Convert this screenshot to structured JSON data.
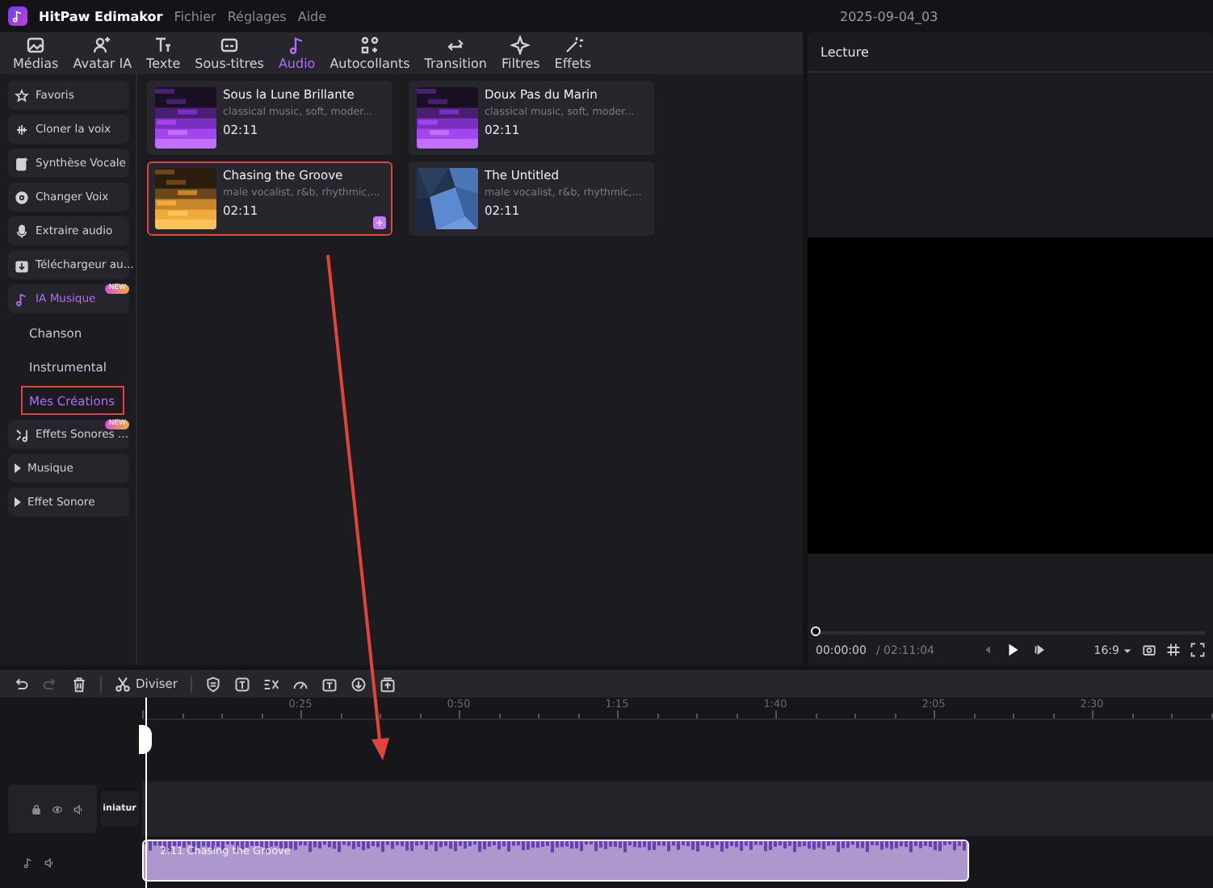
{
  "app": {
    "name": "HitPaw Edimakor",
    "menu": [
      "Fichier",
      "Réglages",
      "Aide"
    ],
    "project": "2025-09-04_03"
  },
  "tabs": [
    {
      "label": "Médias",
      "selected": false
    },
    {
      "label": "Avatar IA",
      "selected": false
    },
    {
      "label": "Texte",
      "selected": false
    },
    {
      "label": "Sous-titres",
      "selected": false
    },
    {
      "label": "Audio",
      "selected": true
    },
    {
      "label": "Autocollants",
      "selected": false
    },
    {
      "label": "Transition",
      "selected": false
    },
    {
      "label": "Filtres",
      "selected": false
    },
    {
      "label": "Effets",
      "selected": false
    }
  ],
  "sidebar": {
    "items": [
      {
        "label": "Favoris",
        "kind": "item",
        "selected": false
      },
      {
        "label": "Cloner la voix",
        "kind": "item",
        "selected": false
      },
      {
        "label": "Synthèse Vocale",
        "kind": "item",
        "selected": false
      },
      {
        "label": "Changer Voix",
        "kind": "item",
        "selected": false
      },
      {
        "label": "Extraire audio",
        "kind": "item",
        "selected": false
      },
      {
        "label": "Téléchargeur au...",
        "kind": "item",
        "selected": false
      },
      {
        "label": "IA Musique",
        "kind": "item",
        "selected": true,
        "badge": "NEW",
        "children": [
          {
            "label": "Chanson",
            "selected": false
          },
          {
            "label": "Instrumental",
            "selected": false
          },
          {
            "label": "Mes Créations",
            "selected": true
          }
        ]
      },
      {
        "label": "Effets Sonores ...",
        "kind": "item",
        "selected": false,
        "badge": "NEW"
      },
      {
        "label": "Musique",
        "kind": "folder",
        "selected": false,
        "expanded": false
      },
      {
        "label": "Effet Sonore",
        "kind": "folder",
        "selected": false,
        "expanded": false
      }
    ]
  },
  "tracks": [
    {
      "title": "Sous la Lune Brillante",
      "tags": "classical music, soft, moder...",
      "duration": "02:11",
      "selected": false
    },
    {
      "title": "Doux Pas du Marin",
      "tags": "classical music, soft, moder...",
      "duration": "02:11",
      "selected": false
    },
    {
      "title": "Chasing the Groove",
      "tags": "male vocalist, r&b, rhythmic,...",
      "duration": "02:11",
      "selected": true
    },
    {
      "title": "The Untitled",
      "tags": "male vocalist, r&b, rhythmic,...",
      "duration": "02:11",
      "selected": false
    }
  ],
  "preview": {
    "title": "Lecture",
    "current_time": "00:00:00",
    "total_time": "/ 02:11:04",
    "level": 0,
    "aspect": "16:9"
  },
  "timeline": {
    "split_label": "Diviser",
    "ruler": [
      "0:25",
      "0:50",
      "1:15",
      "1:40",
      "2:05",
      "2:30"
    ],
    "thumbnail_label": "iniatur",
    "clip_label": "2:11 Chasing the Groove"
  }
}
